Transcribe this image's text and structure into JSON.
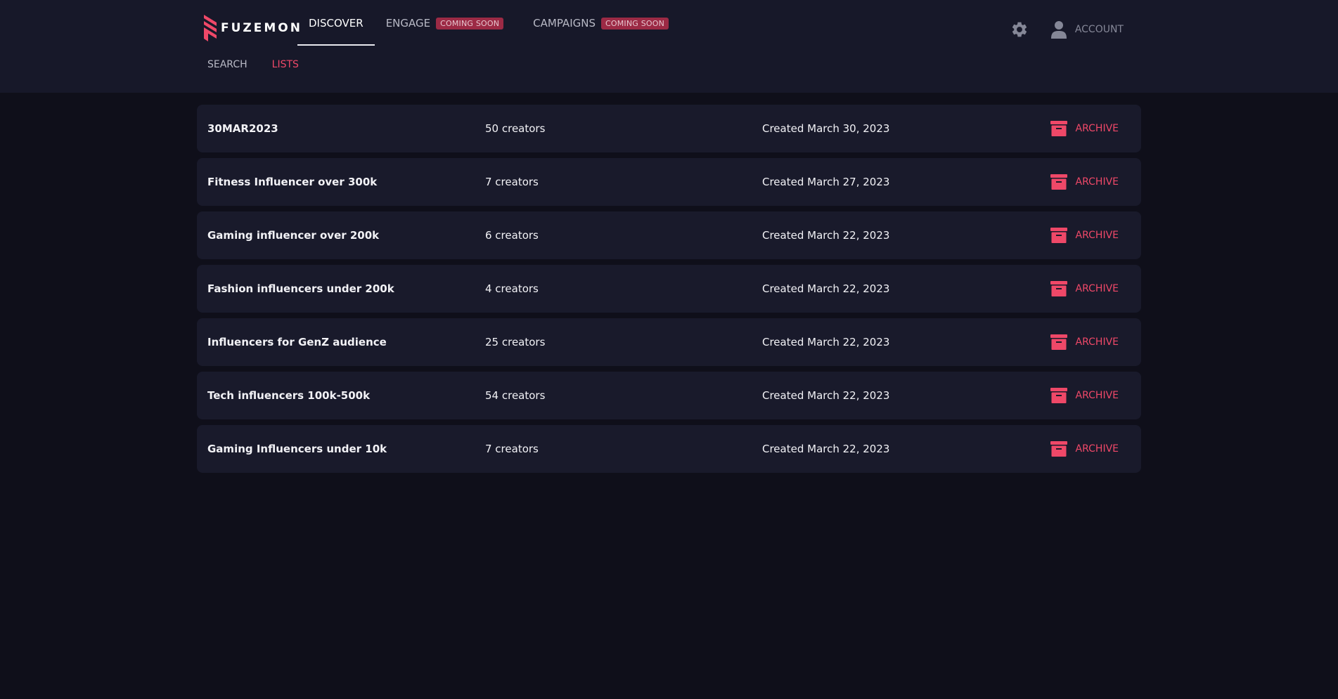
{
  "brand": {
    "name": "FUZEMON",
    "accent": "#ef4868"
  },
  "nav": {
    "discover": "DISCOVER",
    "engage": "ENGAGE",
    "engage_badge": "COMING SOON",
    "campaigns": "CAMPAIGNS",
    "campaigns_badge": "COMING SOON"
  },
  "header_tools": {
    "settings_icon": "gear-icon",
    "account_icon": "user-icon",
    "account_label": "ACCOUNT"
  },
  "subnav": {
    "search": "SEARCH",
    "lists": "LISTS"
  },
  "lists": [
    {
      "name": "30MAR2023",
      "count": "50 creators",
      "created": "Created March 30, 2023",
      "action": "ARCHIVE"
    },
    {
      "name": "Fitness Influencer over 300k",
      "count": "7 creators",
      "created": "Created March 27, 2023",
      "action": "ARCHIVE"
    },
    {
      "name": "Gaming influencer over 200k",
      "count": "6 creators",
      "created": "Created March 22, 2023",
      "action": "ARCHIVE"
    },
    {
      "name": "Fashion influencers under 200k",
      "count": "4 creators",
      "created": "Created March 22, 2023",
      "action": "ARCHIVE"
    },
    {
      "name": "Influencers for GenZ audience",
      "count": "25 creators",
      "created": "Created March 22, 2023",
      "action": "ARCHIVE"
    },
    {
      "name": "Tech influencers 100k-500k",
      "count": "54 creators",
      "created": "Created March 22, 2023",
      "action": "ARCHIVE"
    },
    {
      "name": "Gaming Influencers under 10k",
      "count": "7 creators",
      "created": "Created March 22, 2023",
      "action": "ARCHIVE"
    }
  ]
}
